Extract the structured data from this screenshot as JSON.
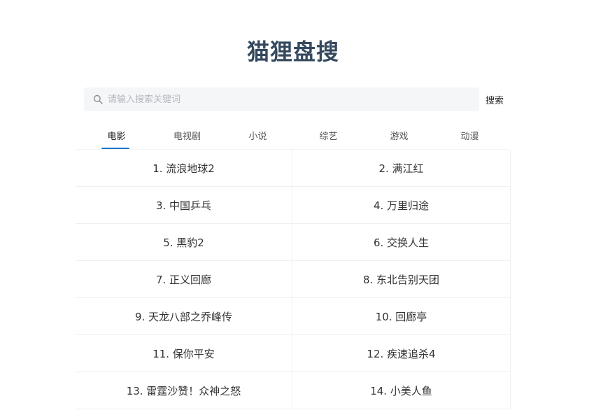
{
  "title": "猫狸盘搜",
  "search": {
    "placeholder": "请输入搜索关键词",
    "button_label": "搜索"
  },
  "tabs": [
    {
      "label": "电影",
      "active": true
    },
    {
      "label": "电视剧",
      "active": false
    },
    {
      "label": "小说",
      "active": false
    },
    {
      "label": "综艺",
      "active": false
    },
    {
      "label": "游戏",
      "active": false
    },
    {
      "label": "动漫",
      "active": false
    }
  ],
  "list": [
    "1. 流浪地球2",
    "2. 满江红",
    "3. 中国乒乓",
    "4. 万里归途",
    "5. 黑豹2",
    "6. 交换人生",
    "7. 正义回廊",
    "8. 东北告别天团",
    "9. 天龙八部之乔峰传",
    "10. 回廊亭",
    "11. 保你平安",
    "12. 疾速追杀4",
    "13. 雷霆沙赞！众神之怒",
    "14. 小美人鱼"
  ],
  "colors": {
    "title": "#35495e",
    "accent": "#1a73c9",
    "search_bg": "#f5f6f8"
  },
  "icons": {
    "search": "search-icon"
  }
}
